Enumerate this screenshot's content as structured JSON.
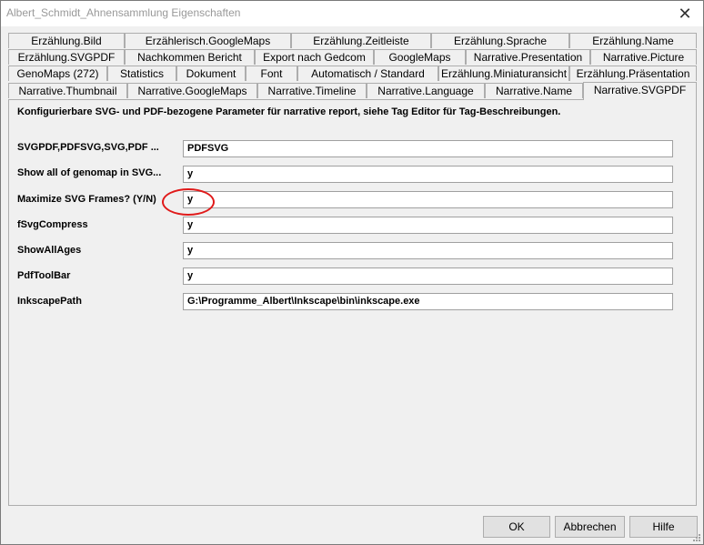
{
  "window": {
    "title": "Albert_Schmidt_Ahnensammlung Eigenschaften",
    "close_glyph": "✕"
  },
  "tabs": {
    "row1": [
      "Erzählung.Bild",
      "Erzählerisch.GoogleMaps",
      "Erzählung.Zeitleiste",
      "Erzählung.Sprache",
      "Erzählung.Name"
    ],
    "row2": [
      "Erzählung.SVGPDF",
      "Nachkommen Bericht",
      "Export nach Gedcom",
      "GoogleMaps",
      "Narrative.Presentation",
      "Narrative.Picture"
    ],
    "row3": [
      "GenoMaps (272)",
      "Statistics",
      "Dokument",
      "Font",
      "Automatisch / Standard",
      "Erzählung.Miniaturansicht",
      "Erzählung.Präsentation"
    ],
    "row4": [
      "Narrative.Thumbnail",
      "Narrative.GoogleMaps",
      "Narrative.Timeline",
      "Narrative.Language",
      "Narrative.Name",
      "Narrative.SVGPDF"
    ],
    "active": "Narrative.SVGPDF"
  },
  "panel": {
    "description": "Konfigurierbare SVG- und PDF-bezogene Parameter für narrative report, siehe Tag Editor für Tag-Beschreibungen.",
    "fields": [
      {
        "label": "SVGPDF,PDFSVG,SVG,PDF ...",
        "value": "PDFSVG"
      },
      {
        "label": "Show all of genomap in SVG...",
        "value": "y"
      },
      {
        "label": "Maximize SVG Frames? (Y/N)",
        "value": "y"
      },
      {
        "label": "fSvgCompress",
        "value": "y"
      },
      {
        "label": "ShowAllAges",
        "value": "y"
      },
      {
        "label": "PdfToolBar",
        "value": "y"
      },
      {
        "label": "InkscapePath",
        "value": "G:\\Programme_Albert\\Inkscape\\bin\\inkscape.exe"
      }
    ]
  },
  "buttons": {
    "ok": "OK",
    "cancel": "Abbrechen",
    "help": "Hilfe"
  },
  "colors": {
    "annotation": "#e01a1a"
  }
}
